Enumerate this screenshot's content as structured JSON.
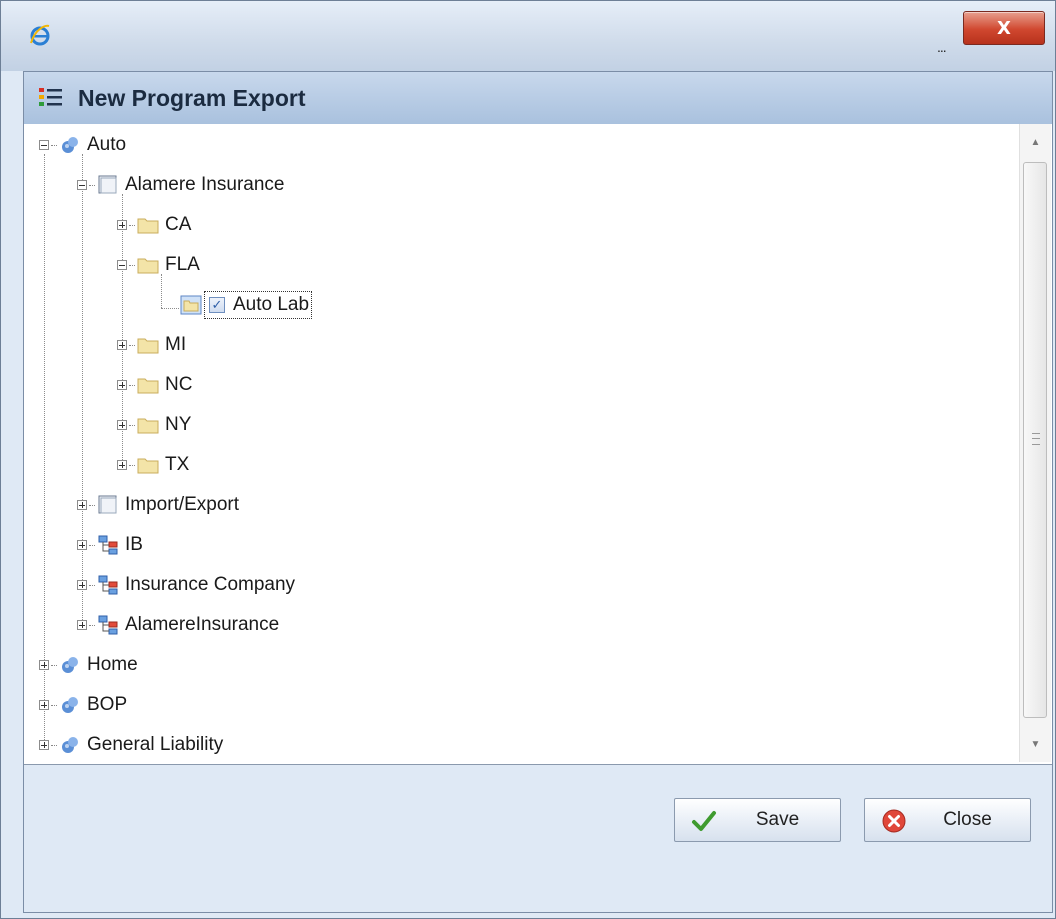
{
  "window": {
    "close_glyph": "X",
    "ellipsis": "..."
  },
  "dialog": {
    "title": "New Program Export"
  },
  "tree": {
    "nodes": [
      {
        "label": "Auto",
        "icon": "product-line-icon",
        "expanded": true
      },
      {
        "label": "Alamere Insurance",
        "icon": "company-icon",
        "expanded": true
      },
      {
        "label": "CA",
        "icon": "folder-icon",
        "expanded": false
      },
      {
        "label": "FLA",
        "icon": "folder-icon",
        "expanded": true
      },
      {
        "label": "Auto Lab",
        "icon": "program-folder-icon",
        "checked": true
      },
      {
        "label": "MI",
        "icon": "folder-icon",
        "expanded": false
      },
      {
        "label": "NC",
        "icon": "folder-icon",
        "expanded": false
      },
      {
        "label": "NY",
        "icon": "folder-icon",
        "expanded": false
      },
      {
        "label": "TX",
        "icon": "folder-icon",
        "expanded": false
      },
      {
        "label": "Import/Export",
        "icon": "company-icon",
        "expanded": false
      },
      {
        "label": "IB",
        "icon": "hierarchy-icon",
        "expanded": false
      },
      {
        "label": "Insurance Company",
        "icon": "hierarchy-icon",
        "expanded": false
      },
      {
        "label": "AlamereInsurance",
        "icon": "hierarchy-icon",
        "expanded": false
      },
      {
        "label": "Home",
        "icon": "product-line-icon",
        "expanded": false
      },
      {
        "label": "BOP",
        "icon": "product-line-icon",
        "expanded": false
      },
      {
        "label": "General Liability",
        "icon": "product-line-icon",
        "expanded": false
      }
    ]
  },
  "buttons": {
    "save_label": "Save",
    "close_label": "Close"
  },
  "colors": {
    "dialog_bg": "#dfe9f5",
    "header_bg": "#b5cae4",
    "title_close": "#d0472f"
  }
}
